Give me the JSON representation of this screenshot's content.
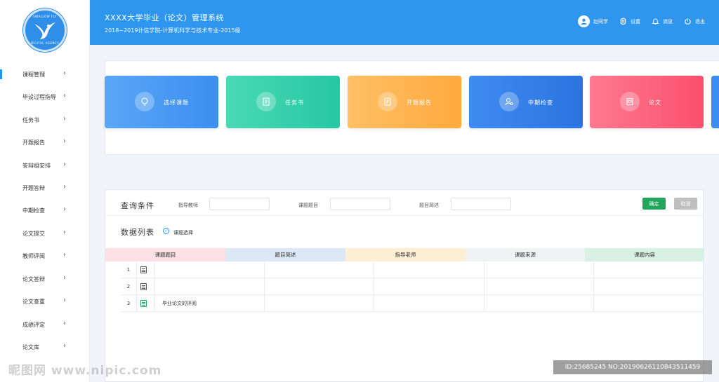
{
  "header": {
    "title": "XXXX大学毕业（论文）管理系统",
    "subtitle": "2018~2019计信学院-计算机科学与技术专业-2015级",
    "user": "赵同学",
    "settings": "设置",
    "messages": "消息",
    "logout": "退出"
  },
  "logo": {
    "top_text": "SWALLOW FLY",
    "bottom_text": "DIGITAL AGENCY"
  },
  "sidebar": {
    "items": [
      {
        "label": "课程管理"
      },
      {
        "label": "毕设过程指导"
      },
      {
        "label": "任务书"
      },
      {
        "label": "开题报告"
      },
      {
        "label": "答辩组安排"
      },
      {
        "label": "开题答辩"
      },
      {
        "label": "中期检查"
      },
      {
        "label": "论文提交"
      },
      {
        "label": "教师评阅"
      },
      {
        "label": "论文答辩"
      },
      {
        "label": "论文查重"
      },
      {
        "label": "成绩评定"
      },
      {
        "label": "论文库"
      }
    ]
  },
  "cards": [
    {
      "label": "选择课题",
      "icon": "lightbulb-icon",
      "color_from": "#5aa7f8",
      "color_to": "#3b8ef0"
    },
    {
      "label": "任务书",
      "icon": "document-icon",
      "color_from": "#4ad9b5",
      "color_to": "#26c7a3"
    },
    {
      "label": "开题报告",
      "icon": "report-icon",
      "color_from": "#ffc066",
      "color_to": "#ffa93d"
    },
    {
      "label": "中期检查",
      "icon": "user-search-icon",
      "color_from": "#3f8cf0",
      "color_to": "#2a74e0"
    },
    {
      "label": "论文",
      "icon": "paper-icon",
      "color_from": "#ff7a90",
      "color_to": "#fb4f6c"
    }
  ],
  "query": {
    "title": "查询条件",
    "advisor_label": "指导教师",
    "topic_label": "课题题目",
    "summary_label": "题目简述",
    "ok_label": "确定",
    "cancel_label": "取消"
  },
  "list": {
    "title": "数据列表",
    "check_label": "课题选择",
    "columns": [
      {
        "label": "课题题目",
        "bg": "#fde0e6"
      },
      {
        "label": "题目简述",
        "bg": "#dde8f6"
      },
      {
        "label": "指导老师",
        "bg": "#fdeed6"
      },
      {
        "label": "课题来源",
        "bg": "#f1f2f4"
      },
      {
        "label": "课题内容",
        "bg": "#d9f1e5"
      }
    ],
    "rows": [
      {
        "num": "1",
        "topic": ""
      },
      {
        "num": "2",
        "topic": ""
      },
      {
        "num": "3",
        "topic": "毕业论文的评阅"
      }
    ]
  },
  "watermark": {
    "left": "昵图网 www.nipic.com",
    "right": "ID:25685245 NO:20190626110843511459"
  }
}
